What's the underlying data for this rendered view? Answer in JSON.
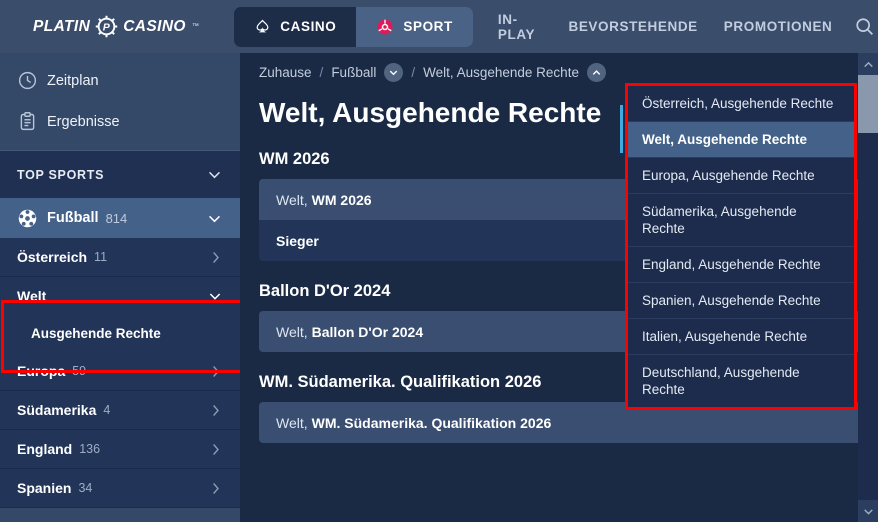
{
  "brand": {
    "name_part1": "PLATIN",
    "name_part2": "CASINO",
    "mark": "p-sun-icon",
    "trademark": "™"
  },
  "topnav": {
    "pills": [
      {
        "label": "CASINO",
        "icon": "spade-icon",
        "active": false
      },
      {
        "label": "SPORT",
        "icon": "football-icon",
        "active": true
      }
    ],
    "links": [
      "IN-PLAY",
      "BEVORSTEHENDE",
      "PROMOTIONEN"
    ],
    "search_icon": "search-icon"
  },
  "sidebar": {
    "top_items": [
      {
        "label": "Zeitplan",
        "icon": "clock-icon"
      },
      {
        "label": "Ergebnisse",
        "icon": "clipboard-icon"
      }
    ],
    "section_header": {
      "label": "TOP SPORTS",
      "icon": "chevron-down-icon"
    },
    "sport": {
      "label": "Fußball",
      "count": "814",
      "icon": "football-ball-icon",
      "chevron": "chevron-down-icon"
    },
    "categories": [
      {
        "label": "Österreich",
        "count": "11",
        "chevron": "chevron-right-icon",
        "selected": false
      },
      {
        "label": "Welt",
        "count": "",
        "chevron": "chevron-down-icon",
        "selected": true,
        "children": [
          {
            "label": "Ausgehende Rechte"
          }
        ]
      },
      {
        "label": "Europa",
        "count": "59",
        "chevron": "chevron-right-icon",
        "selected": false
      },
      {
        "label": "Südamerika",
        "count": "4",
        "chevron": "chevron-right-icon",
        "selected": false
      },
      {
        "label": "England",
        "count": "136",
        "chevron": "chevron-right-icon",
        "selected": false
      },
      {
        "label": "Spanien",
        "count": "34",
        "chevron": "chevron-right-icon",
        "selected": false
      }
    ]
  },
  "breadcrumb": {
    "home": "Zuhause",
    "sep": "/",
    "sport": "Fußball",
    "sport_chevron": "chevron-down-icon",
    "current": "Welt, Ausgehende Rechte",
    "current_chevron": "chevron-up-icon"
  },
  "page": {
    "title": "Welt, Ausgehende Rechte"
  },
  "sections": [
    {
      "title": "WM 2026",
      "head_prefix": "Welt,",
      "head_name": "WM 2026",
      "rows": [
        "Sieger"
      ]
    },
    {
      "title": "Ballon D'Or 2024",
      "head_prefix": "Welt,",
      "head_name": "Ballon D'Or 2024",
      "rows": []
    },
    {
      "title": "WM. Südamerika. Qualifikation 2026",
      "head_prefix": "Welt,",
      "head_name": "WM. Südamerika. Qualifikation 2026",
      "rows": []
    }
  ],
  "dropdown": {
    "items": [
      {
        "label": "Österreich, Ausgehende Rechte",
        "selected": false
      },
      {
        "label": "Welt, Ausgehende Rechte",
        "selected": true
      },
      {
        "label": "Europa, Ausgehende Rechte",
        "selected": false
      },
      {
        "label": "Südamerika, Ausgehende Rechte",
        "selected": false
      },
      {
        "label": "England, Ausgehende Rechte",
        "selected": false
      },
      {
        "label": "Spanien, Ausgehende Rechte",
        "selected": false
      },
      {
        "label": "Italien, Ausgehende Rechte",
        "selected": false
      },
      {
        "label": "Deutschland, Ausgehende Rechte",
        "selected": false
      }
    ]
  },
  "scrollbar": {
    "up_icon": "chevron-up-icon",
    "down_icon": "chevron-down-icon"
  },
  "colors": {
    "page_bg": "#1a2a44",
    "topbar_bg": "#3a4d6b",
    "sidebar_bg": "#344967",
    "accent_active": "#44618a",
    "highlight_red": "#ff0000",
    "sport_pink": "#e0195a",
    "accent_cyan": "#3fa9e0"
  }
}
